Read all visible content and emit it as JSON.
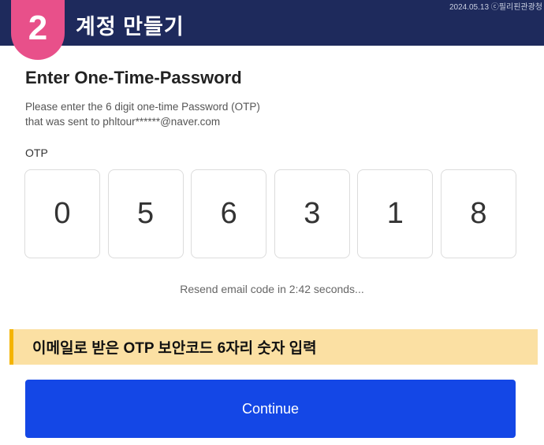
{
  "banner": {
    "step_number": "2",
    "title": "계정 만들기",
    "stamp": "2024.05.13 ⓒ필리핀관광청"
  },
  "form": {
    "title": "Enter One-Time-Password",
    "instruction_line1": "Please enter the 6 digit one-time Password (OTP)",
    "instruction_line2": "that was sent to phltour******@naver.com",
    "otp_label": "OTP",
    "otp_digits": [
      "0",
      "5",
      "6",
      "3",
      "1",
      "8"
    ],
    "resend_text": "Resend email code in 2:42 seconds...",
    "continue_label": "Continue"
  },
  "caption": {
    "text": "이메일로 받은 OTP 보안코드 6자리 숫자 입력"
  },
  "colors": {
    "banner": "#1e2a5c",
    "badge": "#e8508a",
    "caption_bg": "#fbe0a3",
    "caption_accent": "#f4b400",
    "button": "#1447e6"
  }
}
